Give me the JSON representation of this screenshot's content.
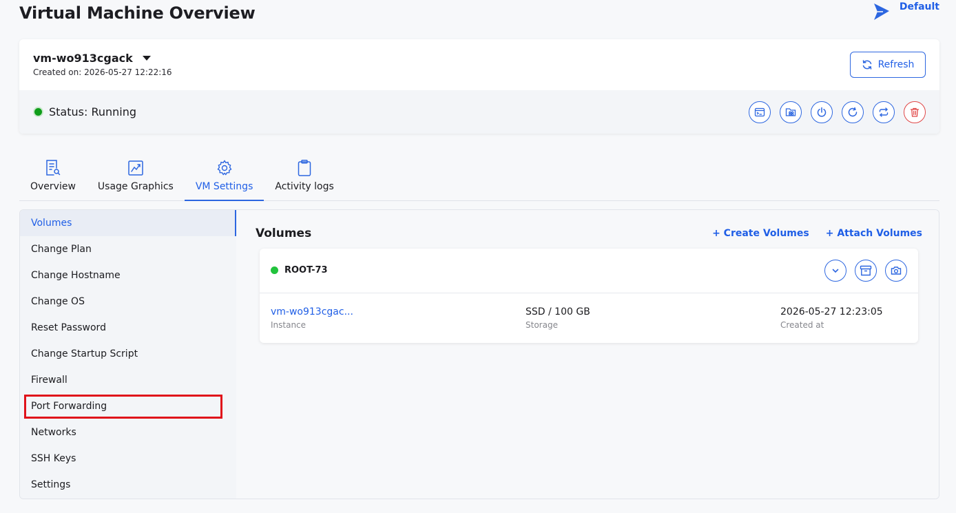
{
  "header": {
    "title": "Virtual Machine Overview",
    "project_label": "Default"
  },
  "vm": {
    "name": "vm-wo913cgack",
    "created": "Created on: 2026-05-27 12:22:16",
    "refresh_label": "Refresh",
    "status": "Status: Running",
    "status_color": "#0f9d1a",
    "actions": [
      {
        "name": "console-icon"
      },
      {
        "name": "file-manager-icon"
      },
      {
        "name": "power-icon"
      },
      {
        "name": "reboot-icon"
      },
      {
        "name": "swap-icon"
      },
      {
        "name": "trash-icon"
      }
    ]
  },
  "tabs": [
    {
      "label": "Overview",
      "icon": "document-search-icon"
    },
    {
      "label": "Usage Graphics",
      "icon": "chart-icon"
    },
    {
      "label": "VM Settings",
      "icon": "gear-icon",
      "active": true
    },
    {
      "label": "Activity logs",
      "icon": "clipboard-icon"
    }
  ],
  "sidebar": {
    "items": [
      {
        "label": "Volumes"
      },
      {
        "label": "Change Plan"
      },
      {
        "label": "Change Hostname"
      },
      {
        "label": "Change OS"
      },
      {
        "label": "Reset Password"
      },
      {
        "label": "Change Startup Script"
      },
      {
        "label": "Firewall"
      },
      {
        "label": "Port Forwarding"
      },
      {
        "label": "Networks"
      },
      {
        "label": "SSH Keys"
      },
      {
        "label": "Settings"
      }
    ]
  },
  "volumes": {
    "title": "Volumes",
    "create_label": "+ Create Volumes",
    "attach_label": "+ Attach Volumes",
    "card": {
      "name": "ROOT-73",
      "instance_value": "vm-wo913cgac...",
      "instance_label": "Instance",
      "storage_value": "SSD / 100 GB",
      "storage_label": "Storage",
      "created_value": "2026-05-27 12:23:05",
      "created_label": "Created at"
    }
  },
  "colors": {
    "accent": "#1f5ee6",
    "danger": "#e04646",
    "highlight": "#e0121a"
  }
}
